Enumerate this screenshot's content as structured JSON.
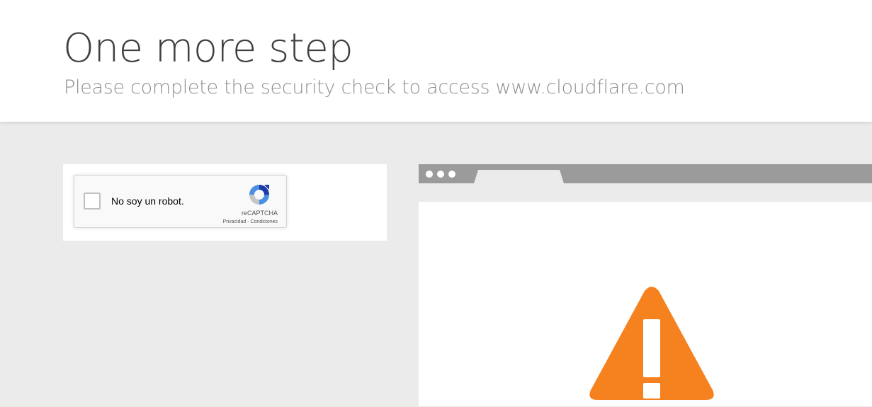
{
  "header": {
    "title": "One more step",
    "subtitle": "Please complete the security check to access www.cloudflare.com"
  },
  "recaptcha": {
    "checkbox_label": "No soy un robot.",
    "brand": "reCAPTCHA",
    "privacy_link": "Privacidad",
    "separator": " - ",
    "terms_link": "Condiciones",
    "logo_icon": "recaptcha-logo-icon"
  },
  "browser_illustration": {
    "warning_icon": "warning-triangle-icon",
    "warning_color": "#f6821f",
    "window_dots": 3
  }
}
